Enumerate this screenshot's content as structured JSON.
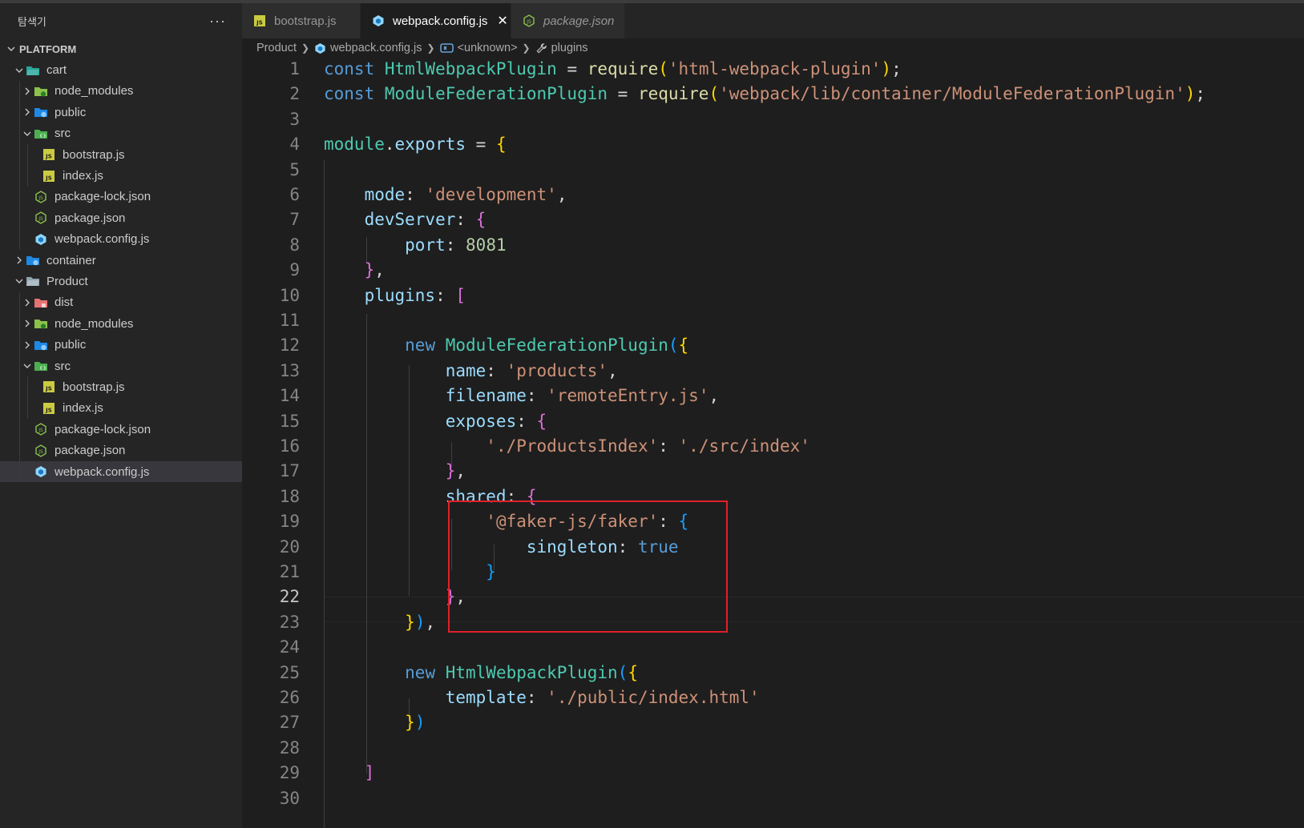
{
  "explorer": {
    "title": "탐색기",
    "more": "···",
    "root": "PLATFORM",
    "items": [
      {
        "label": "cart",
        "depth": 1,
        "kind": "folder-open",
        "chevron": "open"
      },
      {
        "label": "node_modules",
        "depth": 2,
        "kind": "folder-node",
        "chevron": "closed"
      },
      {
        "label": "public",
        "depth": 2,
        "kind": "folder-public",
        "chevron": "closed"
      },
      {
        "label": "src",
        "depth": 2,
        "kind": "folder-src",
        "chevron": "open"
      },
      {
        "label": "bootstrap.js",
        "depth": 3,
        "kind": "js",
        "chevron": "none"
      },
      {
        "label": "index.js",
        "depth": 3,
        "kind": "js",
        "chevron": "none"
      },
      {
        "label": "package-lock.json",
        "depth": 2,
        "kind": "npm",
        "chevron": "none"
      },
      {
        "label": "package.json",
        "depth": 2,
        "kind": "npm",
        "chevron": "none"
      },
      {
        "label": "webpack.config.js",
        "depth": 2,
        "kind": "webpack",
        "chevron": "none"
      },
      {
        "label": "container",
        "depth": 1,
        "kind": "folder-public",
        "chevron": "closed"
      },
      {
        "label": "Product",
        "depth": 1,
        "kind": "folder-plain",
        "chevron": "open"
      },
      {
        "label": "dist",
        "depth": 2,
        "kind": "folder-dist",
        "chevron": "closed"
      },
      {
        "label": "node_modules",
        "depth": 2,
        "kind": "folder-node",
        "chevron": "closed"
      },
      {
        "label": "public",
        "depth": 2,
        "kind": "folder-public",
        "chevron": "closed"
      },
      {
        "label": "src",
        "depth": 2,
        "kind": "folder-src",
        "chevron": "open"
      },
      {
        "label": "bootstrap.js",
        "depth": 3,
        "kind": "js",
        "chevron": "none"
      },
      {
        "label": "index.js",
        "depth": 3,
        "kind": "js",
        "chevron": "none"
      },
      {
        "label": "package-lock.json",
        "depth": 2,
        "kind": "npm",
        "chevron": "none"
      },
      {
        "label": "package.json",
        "depth": 2,
        "kind": "npm",
        "chevron": "none"
      },
      {
        "label": "webpack.config.js",
        "depth": 2,
        "kind": "webpack",
        "chevron": "none",
        "selected": true
      }
    ]
  },
  "tabs": [
    {
      "label": "bootstrap.js",
      "icon": "js",
      "active": false,
      "italic": false
    },
    {
      "label": "webpack.config.js",
      "icon": "webpack",
      "active": true,
      "italic": false,
      "close": "✕"
    },
    {
      "label": "package.json",
      "icon": "npm",
      "active": false,
      "italic": true
    }
  ],
  "breadcrumb": {
    "items": [
      "Product",
      "webpack.config.js",
      "<unknown>",
      "plugins"
    ]
  },
  "editor": {
    "current_line": 22,
    "lines": [
      {
        "n": "1",
        "tokens": [
          [
            "kw",
            "const "
          ],
          [
            "cls",
            "HtmlWebpackPlugin"
          ],
          [
            "pun",
            " = "
          ],
          [
            "fn",
            "require"
          ],
          [
            "b1",
            "("
          ],
          [
            "str",
            "'html-webpack-plugin'"
          ],
          [
            "b1",
            ")"
          ],
          [
            "pun",
            ";"
          ]
        ]
      },
      {
        "n": "2",
        "tokens": [
          [
            "kw",
            "const "
          ],
          [
            "cls",
            "ModuleFederationPlugin"
          ],
          [
            "pun",
            " = "
          ],
          [
            "fn",
            "require"
          ],
          [
            "b1",
            "("
          ],
          [
            "str",
            "'webpack/lib/container/ModuleFederationPlugin'"
          ],
          [
            "b1",
            ")"
          ],
          [
            "pun",
            ";"
          ]
        ]
      },
      {
        "n": "3",
        "tokens": []
      },
      {
        "n": "4",
        "tokens": [
          [
            "cls",
            "module"
          ],
          [
            "pun",
            "."
          ],
          [
            "prop",
            "exports"
          ],
          [
            "pun",
            " = "
          ],
          [
            "b1",
            "{"
          ]
        ]
      },
      {
        "n": "5",
        "tokens": []
      },
      {
        "n": "6",
        "tokens": [
          [
            "pun",
            "    "
          ],
          [
            "prop",
            "mode"
          ],
          [
            "pun",
            ": "
          ],
          [
            "str",
            "'development'"
          ],
          [
            "pun",
            ","
          ]
        ]
      },
      {
        "n": "7",
        "tokens": [
          [
            "pun",
            "    "
          ],
          [
            "prop",
            "devServer"
          ],
          [
            "pun",
            ": "
          ],
          [
            "b2",
            "{"
          ]
        ]
      },
      {
        "n": "8",
        "tokens": [
          [
            "pun",
            "        "
          ],
          [
            "prop",
            "port"
          ],
          [
            "pun",
            ": "
          ],
          [
            "num",
            "8081"
          ]
        ]
      },
      {
        "n": "9",
        "tokens": [
          [
            "pun",
            "    "
          ],
          [
            "b2",
            "}"
          ],
          [
            "pun",
            ","
          ]
        ]
      },
      {
        "n": "10",
        "tokens": [
          [
            "pun",
            "    "
          ],
          [
            "prop",
            "plugins"
          ],
          [
            "pun",
            ": "
          ],
          [
            "b2",
            "["
          ]
        ]
      },
      {
        "n": "11",
        "tokens": []
      },
      {
        "n": "12",
        "tokens": [
          [
            "pun",
            "        "
          ],
          [
            "kw",
            "new "
          ],
          [
            "cls",
            "ModuleFederationPlugin"
          ],
          [
            "b3",
            "("
          ],
          [
            "b1",
            "{"
          ]
        ]
      },
      {
        "n": "13",
        "tokens": [
          [
            "pun",
            "            "
          ],
          [
            "prop",
            "name"
          ],
          [
            "pun",
            ": "
          ],
          [
            "str",
            "'products'"
          ],
          [
            "pun",
            ","
          ]
        ]
      },
      {
        "n": "14",
        "tokens": [
          [
            "pun",
            "            "
          ],
          [
            "prop",
            "filename"
          ],
          [
            "pun",
            ": "
          ],
          [
            "str",
            "'remoteEntry.js'"
          ],
          [
            "pun",
            ","
          ]
        ]
      },
      {
        "n": "15",
        "tokens": [
          [
            "pun",
            "            "
          ],
          [
            "prop",
            "exposes"
          ],
          [
            "pun",
            ": "
          ],
          [
            "b2",
            "{"
          ]
        ]
      },
      {
        "n": "16",
        "tokens": [
          [
            "pun",
            "                "
          ],
          [
            "str",
            "'./ProductsIndex'"
          ],
          [
            "pun",
            ": "
          ],
          [
            "str",
            "'./src/index'"
          ]
        ]
      },
      {
        "n": "17",
        "tokens": [
          [
            "pun",
            "            "
          ],
          [
            "b2",
            "}"
          ],
          [
            "pun",
            ","
          ]
        ]
      },
      {
        "n": "18",
        "tokens": [
          [
            "pun",
            "            "
          ],
          [
            "prop",
            "shared"
          ],
          [
            "pun",
            ": "
          ],
          [
            "b2",
            "{"
          ]
        ]
      },
      {
        "n": "19",
        "tokens": [
          [
            "pun",
            "                "
          ],
          [
            "str",
            "'@faker-js/faker'"
          ],
          [
            "pun",
            ": "
          ],
          [
            "b3",
            "{"
          ]
        ]
      },
      {
        "n": "20",
        "tokens": [
          [
            "pun",
            "                    "
          ],
          [
            "prop",
            "singleton"
          ],
          [
            "pun",
            ": "
          ],
          [
            "kw",
            "true"
          ]
        ]
      },
      {
        "n": "21",
        "tokens": [
          [
            "pun",
            "                "
          ],
          [
            "b3",
            "}"
          ]
        ]
      },
      {
        "n": "22",
        "tokens": [
          [
            "pun",
            "            "
          ],
          [
            "b2",
            "}"
          ],
          [
            "pun",
            ","
          ]
        ]
      },
      {
        "n": "23",
        "tokens": [
          [
            "pun",
            "        "
          ],
          [
            "b1",
            "}"
          ],
          [
            "b3",
            ")"
          ],
          [
            "pun",
            ","
          ]
        ]
      },
      {
        "n": "24",
        "tokens": []
      },
      {
        "n": "25",
        "tokens": [
          [
            "pun",
            "        "
          ],
          [
            "kw",
            "new "
          ],
          [
            "cls",
            "HtmlWebpackPlugin"
          ],
          [
            "b3",
            "("
          ],
          [
            "b1",
            "{"
          ]
        ]
      },
      {
        "n": "26",
        "tokens": [
          [
            "pun",
            "            "
          ],
          [
            "prop",
            "template"
          ],
          [
            "pun",
            ": "
          ],
          [
            "str",
            "'./public/index.html'"
          ]
        ]
      },
      {
        "n": "27",
        "tokens": [
          [
            "pun",
            "        "
          ],
          [
            "b1",
            "}"
          ],
          [
            "b3",
            ")"
          ]
        ]
      },
      {
        "n": "28",
        "tokens": []
      },
      {
        "n": "29",
        "tokens": [
          [
            "pun",
            "    "
          ],
          [
            "b2",
            "]"
          ]
        ]
      },
      {
        "n": "30",
        "tokens": []
      }
    ]
  },
  "colors": {
    "highlight_box": "#e0202a",
    "accent_tab": "#ffffff"
  }
}
